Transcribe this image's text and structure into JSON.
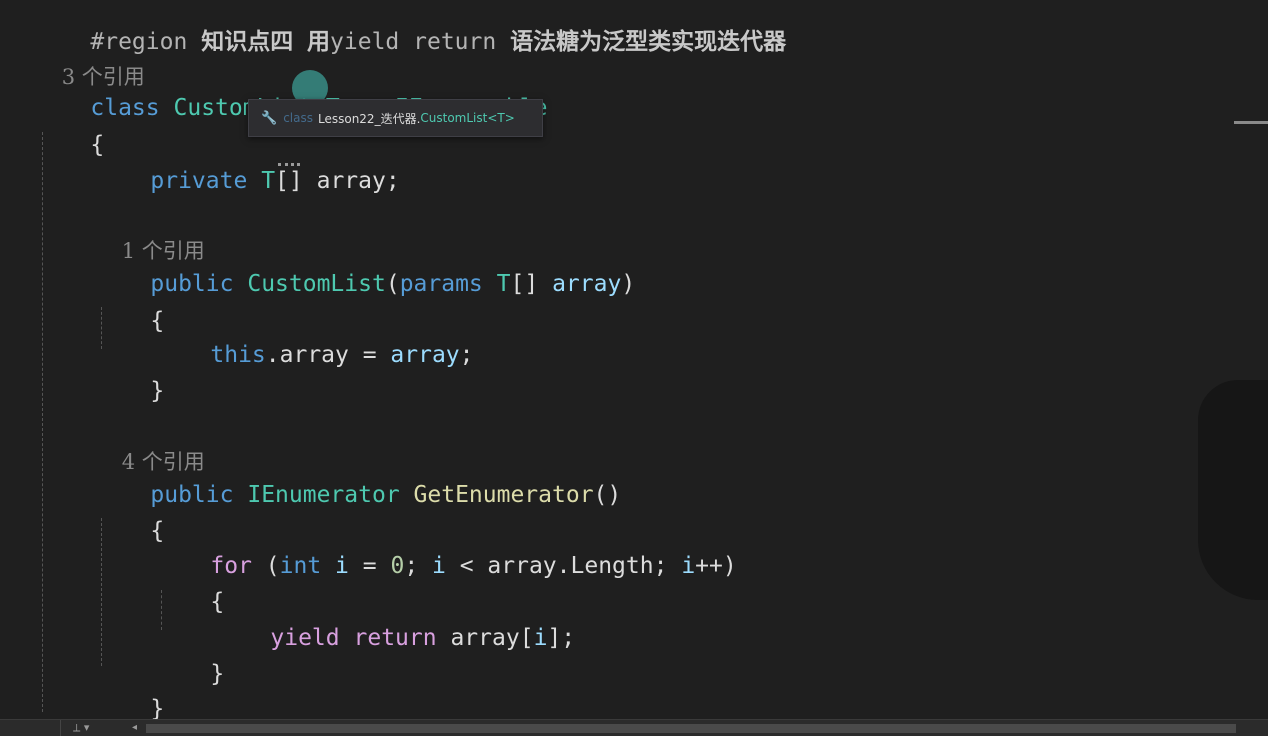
{
  "region_line": {
    "keyword": "#region",
    "title_cn1": "知识点四",
    "title_cn2": "用",
    "title_mid": "yield return",
    "title_cn3": "语法糖为泛型类实现迭代器"
  },
  "codelens": {
    "class_refs": "3 个引用",
    "ctor_refs": "1 个引用",
    "getenum_refs": "4 个引用"
  },
  "code": {
    "class_kw": "class",
    "class_name": "CustomList",
    "type_param_open": "<",
    "type_param": "T",
    "type_param_close": ">",
    "colon": " : ",
    "base_type": "IEnumerable",
    "brace_open": "{",
    "brace_close": "}",
    "field_mod": "private",
    "field_type": "T",
    "field_arr": "[]",
    "field_name": "array",
    "semicolon": ";",
    "ctor_mod": "public",
    "ctor_name": "CustomList",
    "paren_open": "(",
    "params_kw": "params",
    "param_type": "T",
    "param_arr": "[]",
    "param_name": "array",
    "paren_close": ")",
    "this_kw": "this",
    "this_member": ".array",
    "assign": " = ",
    "assign_rhs": "array",
    "ge_mod": "public",
    "ge_type": "IEnumerator",
    "ge_name": "GetEnumerator",
    "ge_parens": "()",
    "for_kw": "for",
    "for_open": " (",
    "int_kw": "int",
    "loop_var": "i",
    "eq_zero": " = ",
    "zero": "0",
    "semi_sp": "; ",
    "loop_var2": "i",
    "lt": " < ",
    "arr_len_obj": "array",
    "arr_len": ".Length",
    "semi_sp2": "; ",
    "loop_var3": "i",
    "incr": "++)",
    "yield_kw": "yield",
    "return_kw": "return",
    "yield_arr": "array",
    "yield_idx_open": "[",
    "yield_idx": "i",
    "yield_idx_close": "];"
  },
  "tooltip": {
    "icon": "🔧",
    "kind": "class",
    "namespace": "Lesson22_迭代器.",
    "class_name": "CustomList<T>"
  },
  "colors": {
    "keyword": "#569cd6",
    "type": "#4ec9b0",
    "identifier": "#9cdcfe",
    "method": "#dcdcaa",
    "control": "#d8a0df",
    "number": "#b5cea8",
    "background": "#1f1f1f"
  },
  "scrollbar": {
    "tools_glyph": "⟂ ▾",
    "left_arrow": "◂"
  }
}
